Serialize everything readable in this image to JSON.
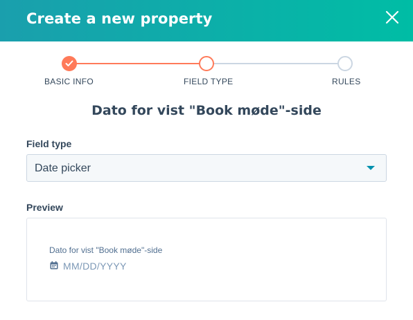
{
  "modal": {
    "title": "Create a new property",
    "close_icon": "close-icon"
  },
  "stepper": {
    "steps": [
      {
        "label": "BASIC INFO",
        "state": "complete"
      },
      {
        "label": "FIELD TYPE",
        "state": "current"
      },
      {
        "label": "RULES",
        "state": "upcoming"
      }
    ]
  },
  "property": {
    "name": "Dato for vist \"Book møde\"-side"
  },
  "field_type": {
    "label": "Field type",
    "selected": "Date picker",
    "caret_icon": "caret-down-icon"
  },
  "preview": {
    "label": "Preview",
    "field_label": "Dato for vist \"Book møde\"-side",
    "placeholder": "MM/DD/YYYY",
    "icon": "calendar-icon"
  },
  "colors": {
    "header_start": "#1a9fad",
    "header_end": "#00bda5",
    "step_active": "#ff7a59",
    "step_inactive": "#cbd6e2",
    "text": "#33475b",
    "caret": "#0091ae"
  }
}
